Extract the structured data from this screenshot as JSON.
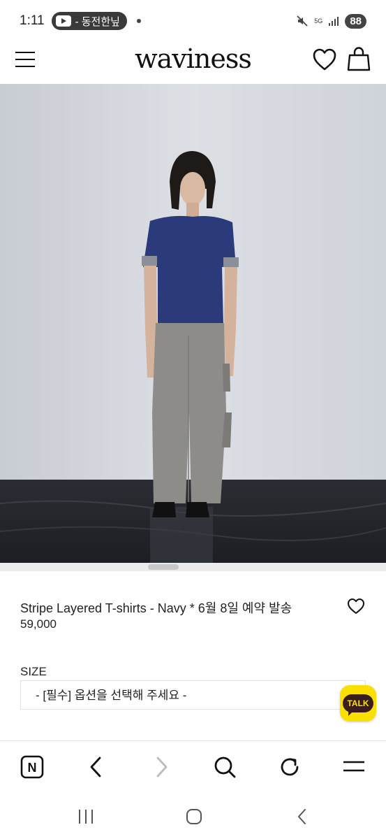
{
  "status_bar": {
    "time": "1:11",
    "media_text": "- 동전한닢",
    "network": "5G",
    "battery": "88"
  },
  "header": {
    "logo": "waviness",
    "icons": [
      "menu-icon",
      "heart-icon",
      "shopping-bag-icon"
    ]
  },
  "product": {
    "title": "Stripe Layered T-shirts - Navy * 6월 8일 예약 발송",
    "price": "59,000",
    "size_label": "SIZE",
    "size_placeholder": "- [필수] 옵션을 선택해 주세요 -"
  },
  "chat_button": {
    "label": "TALK"
  },
  "browser_toolbar": {
    "icons": [
      "naver-n-icon",
      "back-icon",
      "forward-icon",
      "search-icon",
      "refresh-icon",
      "menu-icon"
    ],
    "naver_letter": "N"
  },
  "system_nav": {
    "icons": [
      "recent-apps-icon",
      "home-icon",
      "back-icon"
    ]
  },
  "colors": {
    "kakao_yellow": "#f9e000",
    "kakao_brown": "#3a1d1d",
    "shirt_navy": "#2b3a7a"
  }
}
